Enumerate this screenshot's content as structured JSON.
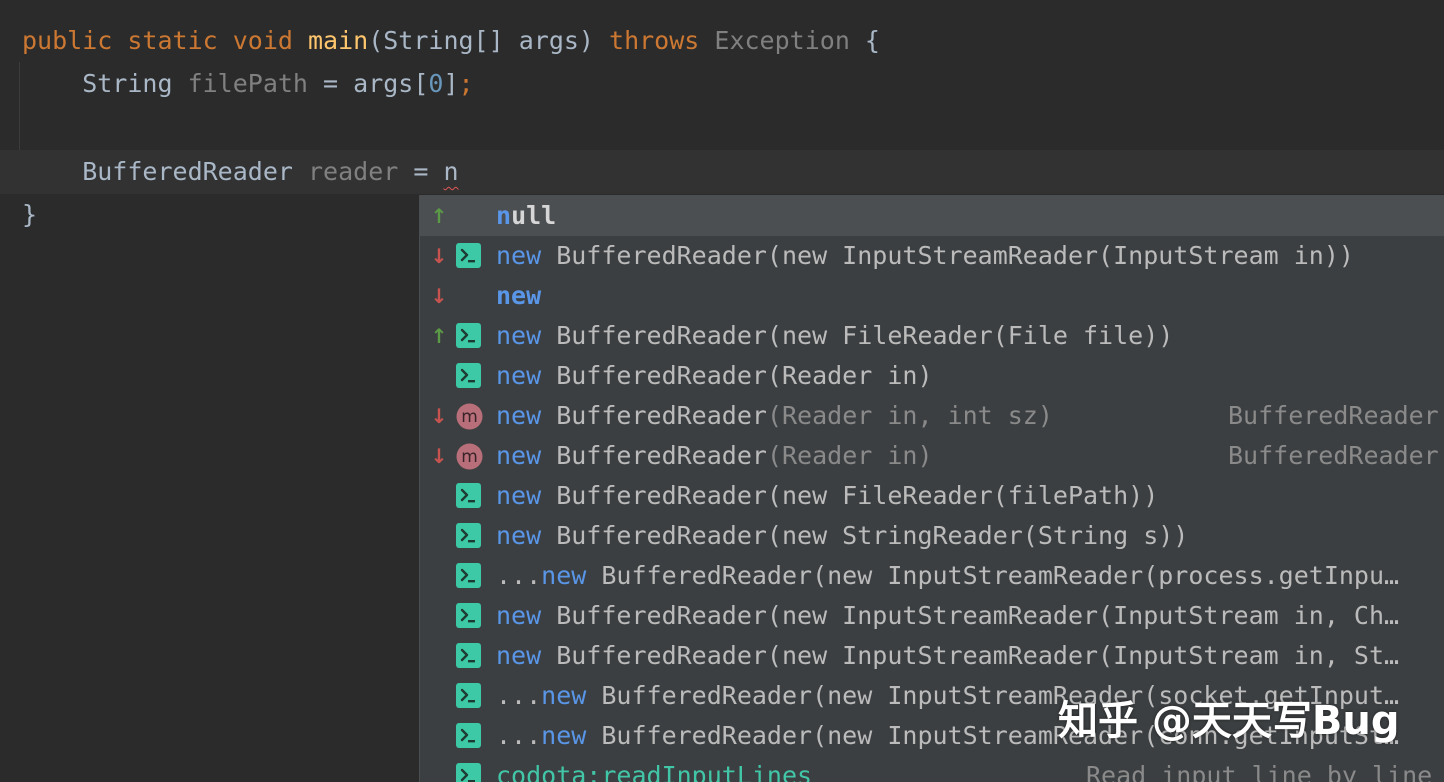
{
  "editor": {
    "lines": [
      {
        "kw1": "public static void ",
        "fn": "main",
        "p1": "(String[] args) ",
        "kw2": "throws",
        "sp": " ",
        "exc": "Exception",
        "brace": " {"
      },
      {
        "type": "    String ",
        "var": "filePath",
        "assign": " = args[",
        "idx": "0",
        "close": "]",
        "semi": ";"
      },
      {
        "type": "    BufferedReader ",
        "var": "reader",
        "assign": " = ",
        "typed": "n"
      },
      {
        "brace": "}"
      }
    ]
  },
  "completion": {
    "items": [
      {
        "arrow": "↑",
        "icon": "none",
        "p1": "n",
        "p2": "ull",
        "p3": "",
        "type": ""
      },
      {
        "arrow": "↓",
        "icon": "template-icon",
        "p1": "new",
        "p2": " BufferedReader(new InputStreamReader(InputStream in))",
        "p3": "",
        "type": ""
      },
      {
        "arrow": "↓",
        "icon": "none",
        "p1": "new",
        "p2": "",
        "p3": "",
        "type": ""
      },
      {
        "arrow": "↑",
        "icon": "template-icon",
        "p1": "new",
        "p2": " BufferedReader(new FileReader(File file))",
        "p3": "",
        "type": ""
      },
      {
        "arrow": "",
        "icon": "template-icon",
        "p1": "new",
        "p2": " BufferedReader(Reader in)",
        "p3": "",
        "type": ""
      },
      {
        "arrow": "↓",
        "icon": "method-icon",
        "p1": "new",
        "p2": " BufferedReader",
        "p3": "(Reader in, int sz)",
        "type": "BufferedReader"
      },
      {
        "arrow": "↓",
        "icon": "method-icon",
        "p1": "new",
        "p2": " BufferedReader",
        "p3": "(Reader in)",
        "type": "BufferedReader"
      },
      {
        "arrow": "",
        "icon": "template-icon",
        "p1": "new",
        "p2": " BufferedReader(new FileReader(filePath))",
        "p3": "",
        "type": ""
      },
      {
        "arrow": "",
        "icon": "template-icon",
        "p1": "new",
        "p2": " BufferedReader(new StringReader(String s))",
        "p3": "",
        "type": ""
      },
      {
        "arrow": "",
        "icon": "template-icon",
        "p0": "...",
        "p1": "new",
        "p2": " BufferedReader(new InputStreamReader(process.getInpu…",
        "p3": "",
        "type": ""
      },
      {
        "arrow": "",
        "icon": "template-icon",
        "p1": "new",
        "p2": " BufferedReader(new InputStreamReader(InputStream in, Ch…",
        "p3": "",
        "type": ""
      },
      {
        "arrow": "",
        "icon": "template-icon",
        "p1": "new",
        "p2": " BufferedReader(new InputStreamReader(InputStream in, St…",
        "p3": "",
        "type": ""
      },
      {
        "arrow": "",
        "icon": "template-icon",
        "p0": "...",
        "p1": "new",
        "p2": " BufferedReader(new InputStreamReader(socket.getInput…",
        "p3": "",
        "type": ""
      },
      {
        "arrow": "",
        "icon": "template-icon",
        "p0": "...",
        "p1": "new",
        "p2": " BufferedReader(new InputStreamReader(conn.getInputSt…",
        "p3": "",
        "type": ""
      },
      {
        "arrow": "",
        "icon": "template-icon",
        "p1": "",
        "p2": "",
        "p3": "",
        "codota": "codota:readInputLines",
        "type": "Read input line by line"
      }
    ]
  },
  "colors": {
    "background": "#2b2b2b",
    "popup": "#3c3f41",
    "keyword": "#cc7832",
    "function": "#ffc66d",
    "highlight": "#5a96e8",
    "template_icon": "#3dc9a5",
    "method_icon": "#b86f7a"
  },
  "watermark": {
    "text": "知乎 @天天写Bug"
  }
}
